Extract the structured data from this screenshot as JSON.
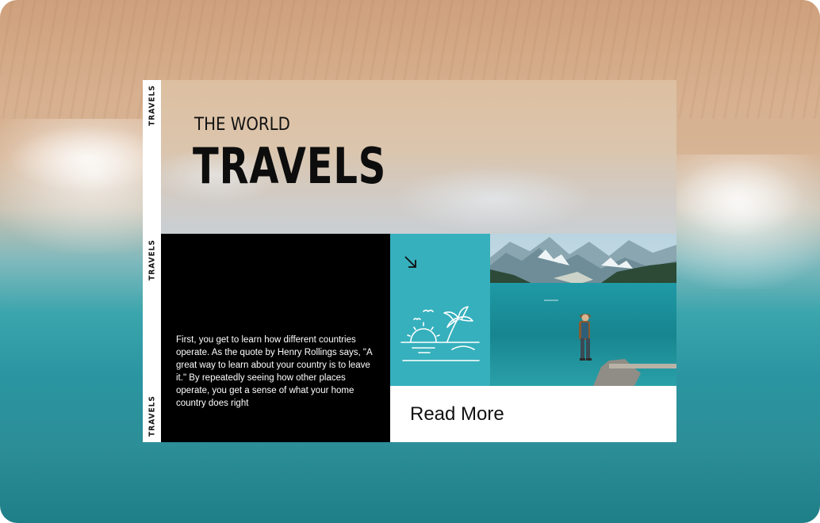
{
  "card": {
    "spine_labels": [
      "TRAVELS",
      "TRAVELS",
      "TRAVELS"
    ],
    "kicker": "THE WORLD",
    "headline": "TRAVELS",
    "body": "First, you get to learn how different countries operate. As the quote by Henry Rollings says, \"A great way to learn about your country is to leave it.\" By repeatedly seeing how other places operate, you get a sense of what your home country does right",
    "cta_label": "Read More"
  },
  "icons": {
    "arrow": "arrow-down-right-icon",
    "beach": "beach-palm-sun-icon"
  },
  "colors": {
    "teal_accent": "#36b0bd",
    "black_panel": "#000000",
    "text_dark": "#111111"
  }
}
